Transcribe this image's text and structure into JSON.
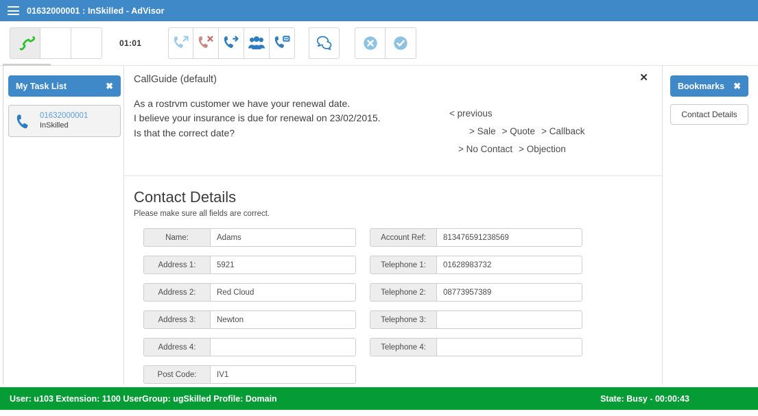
{
  "titlebar": {
    "menu_icon": "hamburger-menu-icon",
    "title": "01632000001 : InSkilled - AdVisor",
    "background": "#4089c9"
  },
  "toolbar": {
    "timer": "01:01",
    "call_controls": [
      {
        "name": "answer-call",
        "icon": "green-phone-handset-icon",
        "active": true,
        "label": ""
      },
      {
        "name": "toolbar-slot-2",
        "icon": "",
        "active": false,
        "label": ""
      },
      {
        "name": "toolbar-slot-3",
        "icon": "",
        "active": false,
        "label": ""
      }
    ],
    "actions": [
      {
        "name": "outbound-call",
        "icon": "phone-outgoing-icon",
        "color": "#9dcbe8"
      },
      {
        "name": "end-call",
        "icon": "phone-hangup-icon",
        "color": "#c98a85"
      },
      {
        "name": "transfer-call",
        "icon": "phone-forward-icon",
        "color": "#2e7dbf"
      },
      {
        "name": "conference-call",
        "icon": "people-group-icon",
        "color": "#2e7dbf"
      },
      {
        "name": "call-recycle",
        "icon": "phone-recycle-icon",
        "color": "#2e7dbf"
      },
      {
        "name": "chat",
        "icon": "speech-bubbles-icon",
        "color": "#2e7dbf"
      }
    ],
    "decision": [
      {
        "name": "reject",
        "icon": "circle-cross-icon",
        "color": "#8ec2e3"
      },
      {
        "name": "accept",
        "icon": "circle-check-icon",
        "color": "#8ec2e3"
      }
    ]
  },
  "left_sidebar": {
    "header": "My Task List",
    "close_label": "✖",
    "tasks": [
      {
        "icon": "phone-handset-icon",
        "number": "01632000001",
        "sub": "InSkilled"
      }
    ]
  },
  "callguide": {
    "title": "CallGuide (default)",
    "close_label": "✕",
    "script_lines": [
      "As a rostrvm customer we have your renewal date.",
      "I believe your insurance is due for renewal on 23/02/2015.",
      "Is that the correct date?"
    ],
    "previous_label": "< previous",
    "options_row1": [
      "> Sale",
      "> Quote",
      "> Callback"
    ],
    "options_row2": [
      "> No Contact",
      "> Objection"
    ]
  },
  "contact_details": {
    "title": "Contact Details",
    "subtitle": "Please make sure all fields are correct.",
    "left_fields": [
      {
        "label": "Name:",
        "value": "Adams",
        "name": "name"
      },
      {
        "label": "Address 1:",
        "value": "5921",
        "name": "address-1"
      },
      {
        "label": "Address 2:",
        "value": "Red Cloud",
        "name": "address-2"
      },
      {
        "label": "Address 3:",
        "value": "Newton",
        "name": "address-3"
      },
      {
        "label": "Address 4:",
        "value": "",
        "name": "address-4"
      },
      {
        "label": "Post Code:",
        "value": "IV1",
        "name": "post-code"
      }
    ],
    "right_fields": [
      {
        "label": "Account Ref:",
        "value": "813476591238569",
        "name": "account-ref"
      },
      {
        "label": "Telephone 1:",
        "value": "01628983732",
        "name": "telephone-1"
      },
      {
        "label": "Telephone 2:",
        "value": "08773957389",
        "name": "telephone-2"
      },
      {
        "label": "Telephone 3:",
        "value": "",
        "name": "telephone-3"
      },
      {
        "label": "Telephone 4:",
        "value": "",
        "name": "telephone-4"
      }
    ]
  },
  "right_sidebar": {
    "header": "Bookmarks",
    "close_label": "✖",
    "items": [
      {
        "label": "Contact Details",
        "name": "contact-details"
      }
    ]
  },
  "statusbar": {
    "left": "User: u103 Extension: 1100 UserGroup: ugSkilled Profile: Domain",
    "right": "State: Busy - 00:00:43",
    "background": "#059b35"
  }
}
